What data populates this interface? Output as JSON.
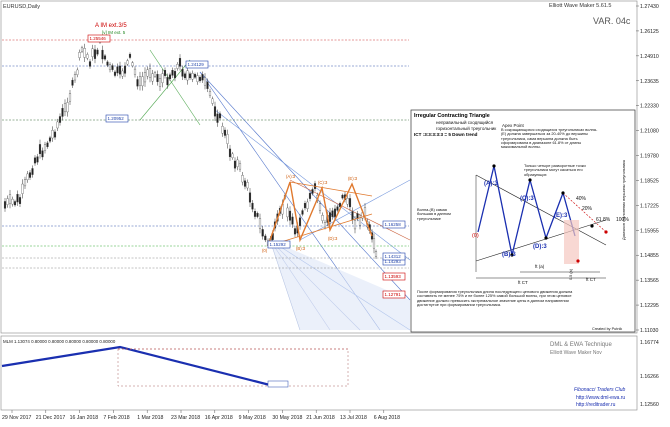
{
  "window": {
    "symbol_title": "EURUSD,Daily",
    "indicator_title": "Elliott Wave Maker 5.61.5",
    "var_label": "VAR. 04c",
    "a_im_label": "A IM ext.3/5",
    "v_im_label": "[v] IM ext. 5",
    "created_by": "Created by Putnik"
  },
  "chart_data": {
    "type": "candlestick",
    "title": "EURUSD,Daily",
    "x_ticks": [
      "29 Nov 2017",
      "21 Dec 2017",
      "16 Jan 2018",
      "7 Feb 2018",
      "1 Mar 2018",
      "23 Mar 2018",
      "16 Apr 2018",
      "9 May 2018",
      "30 May 2018",
      "21 Jun 2018",
      "13 Jul 2018",
      "6 Aug 2018"
    ],
    "y_ticks": [
      "1.27430",
      "1.26125",
      "1.24910",
      "1.23635",
      "1.22330",
      "1.21080",
      "1.19780",
      "1.18525",
      "1.17225",
      "1.15955",
      "1.14855",
      "1.13565",
      "1.12295",
      "1.11030"
    ],
    "ylim": [
      1.1103,
      1.2743
    ],
    "price_boxes": [
      {
        "value": "1.25546",
        "color": "#cc0000"
      },
      {
        "value": "1.24129",
        "color": "#2244aa"
      },
      {
        "value": "1.20952",
        "color": "#2244aa"
      },
      {
        "value": "1.15292",
        "color": "#2244aa"
      },
      {
        "value": "1.14293",
        "color": "#2244aa"
      },
      {
        "value": "1.13593",
        "color": "#cc0000"
      },
      {
        "value": "1.12791",
        "color": "#cc0000"
      },
      {
        "value": "1.16258",
        "color": "#2244aa"
      },
      {
        "value": "1.14312",
        "color": "#2244aa"
      }
    ],
    "wave_labels": [
      "(A):3",
      "(B):3",
      "(C):3",
      "(D):3",
      "(E):3",
      "(0)"
    ],
    "indicator": {
      "label": "MLM 1.13074 0.80000 0.80000 0.80000 0.80000 0.80000",
      "y_ticks": [
        "1.16774",
        "1.16266",
        "1.12560"
      ],
      "legend_lines": [
        "DML & EWA Technique",
        "Elliott Wave Maker Nov"
      ],
      "footer_lines": [
        "Fibonacci Traders Club",
        "http://www.dml-ewa.ru",
        "http://reditrader.ru"
      ]
    }
  },
  "panel": {
    "title": "Irregular Contracting Triangle",
    "sub1": "неправильный сходящийся",
    "sub2": "горизонтальный треугольник",
    "formula": "ICT :3:3:3:3:3 = 5 Down trend",
    "apex_head": "Apex Point",
    "apex_text": "В сокращающихся сходящихся треугольниках волна-(E) должна завершаться за 20-40% до вершины треугольника, сама вершина должна быть сформирована в диапазоне 61.8% от длины максимальной волны.",
    "note_tri": "Только четыре разворотные точки треугольника могут касаться его образующих",
    "note_b": "Волна-(B) самая большая в данном треугольнике",
    "bottom_text": "После формирования треугольника длина последующего ценового движения должна составлять не менее 75% и не более 125% самой большой волны, при этом ценовое движение должно превысить экстремальное значение цены в данном направлении достигнутое при формировании треугольника.",
    "side_text": "Диапазон отклонения вершины треугольника",
    "pct_40": "40%",
    "pct_20": "20%",
    "pct_618": "61.8%",
    "pct_100": "100%",
    "tct_1": "ft CT",
    "tct_2": "ft CT",
    "tct_3": "ft (a)",
    "tct_4": "0.5 (a)",
    "lbl_A": "(A):3",
    "lbl_B": "(B):3",
    "lbl_C": "(C):3",
    "lbl_D": "(D):3",
    "lbl_E": "(E):3",
    "lbl_0": "(0)"
  }
}
